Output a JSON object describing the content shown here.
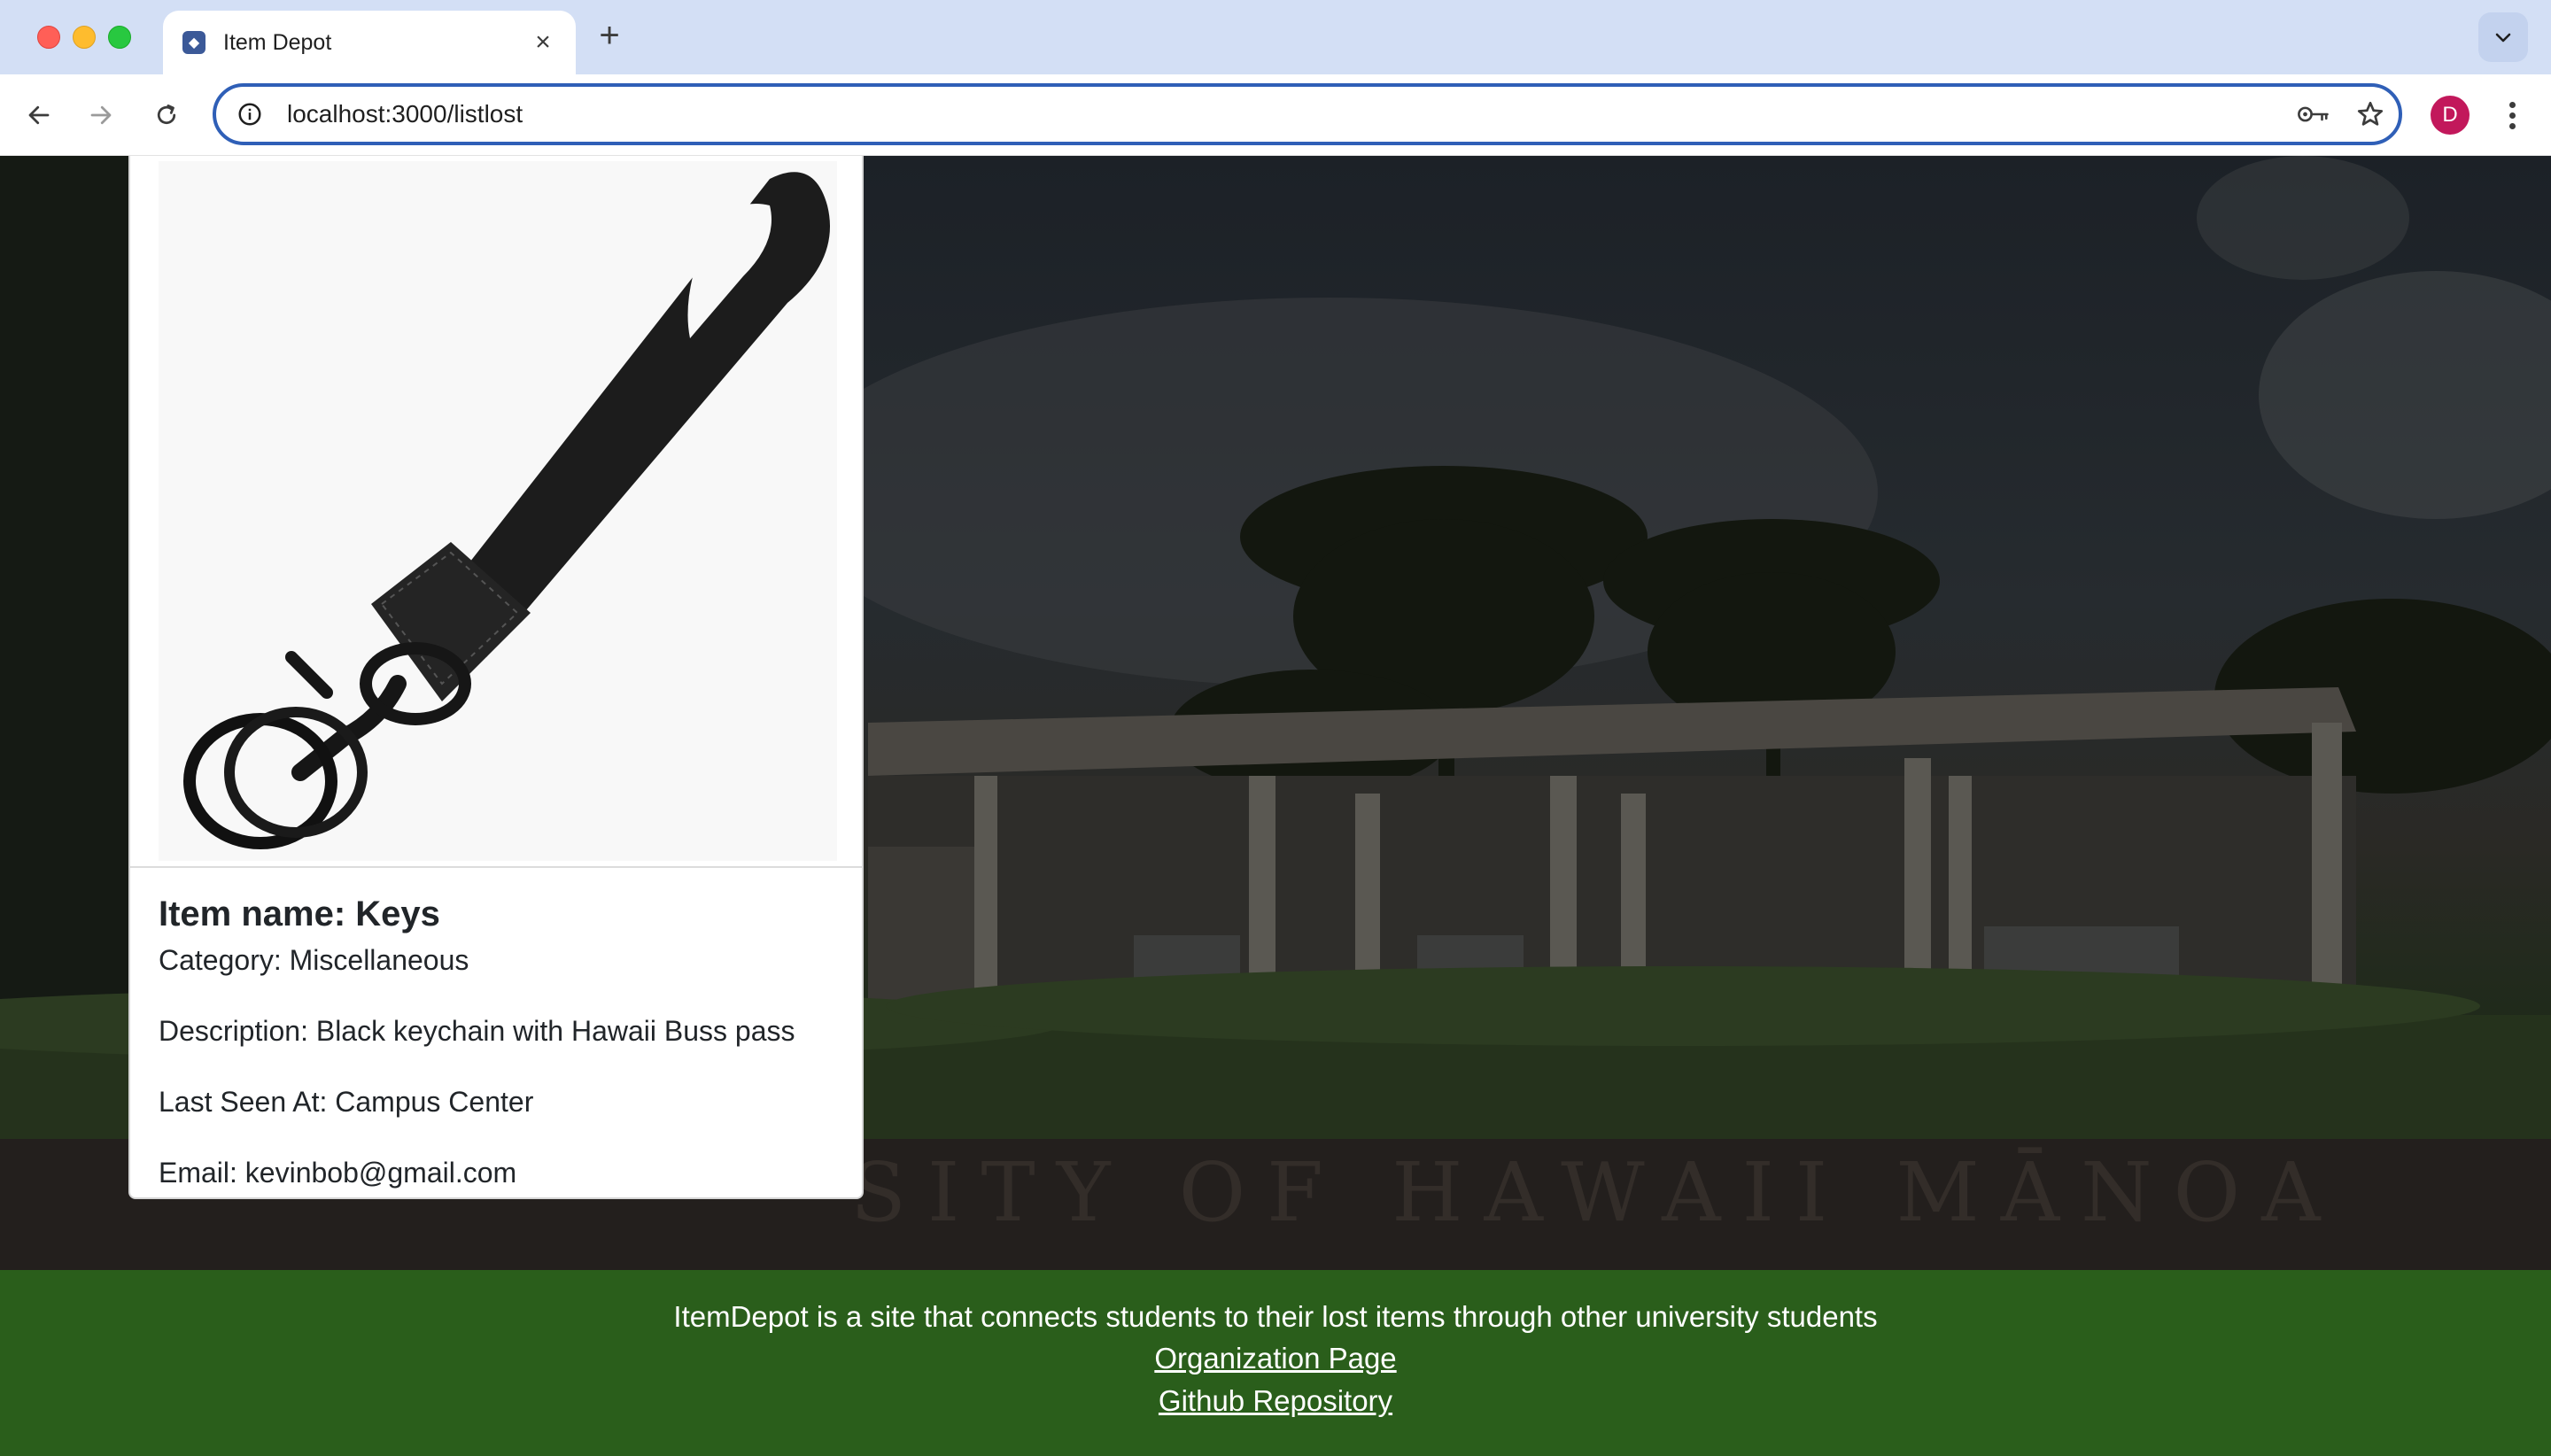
{
  "browser": {
    "tab_title": "Item Depot",
    "tab_close": "×",
    "new_tab": "+",
    "url_host": "localhost:3000/listlost",
    "profile_initial": "D"
  },
  "card": {
    "image_alt": "Black keychain with wrist strap",
    "title": "Item name: Keys",
    "category": "Category: Miscellaneous",
    "description": "Description: Black keychain with Hawaii Buss pass",
    "last_seen": "Last Seen At: Campus Center",
    "email": "Email: kevinbob@gmail.com"
  },
  "hero": {
    "sign_text": "SITY OF HAWAII MĀNOA"
  },
  "footer": {
    "text": "ItemDepot is a site that connects students to their lost items through other university students",
    "org_link": "Organization Page",
    "repo_link": "Github Repository"
  },
  "colors": {
    "footer_bg": "#2a5e1b",
    "omnibox_border": "#2f5fb7",
    "profile_avatar": "#c2185b"
  }
}
